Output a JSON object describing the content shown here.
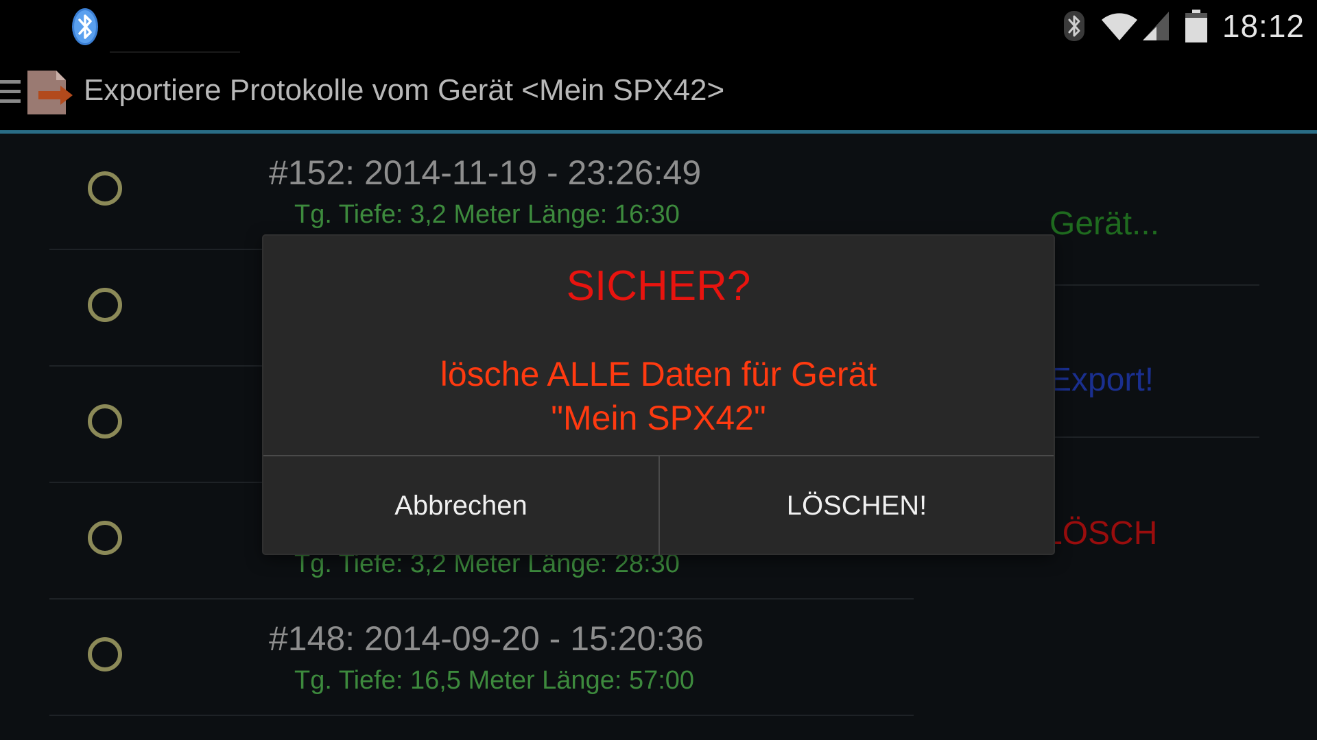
{
  "status_bar": {
    "time": "18:12",
    "icons": [
      "bluetooth-icon",
      "bluetooth-status-icon",
      "wifi-icon",
      "signal-icon",
      "battery-icon"
    ]
  },
  "action_bar": {
    "title": "Exportiere Protokolle vom Gerät <Mein SPX42>",
    "icons": [
      "drawer-menu-icon",
      "export-app-icon"
    ]
  },
  "logs": [
    {
      "title": "#152: 2014-11-19 - 23:26:49",
      "detail": "Tg. Tiefe: 3,2 Meter Länge: 16:30"
    },
    {
      "title": "",
      "detail": ""
    },
    {
      "title": "",
      "detail": ""
    },
    {
      "title": "",
      "detail": "Tg. Tiefe: 3,2 Meter Länge: 28:30"
    },
    {
      "title": "#148: 2014-09-20 - 15:20:36",
      "detail": "Tg. Tiefe: 16,5 Meter Länge: 57:00"
    }
  ],
  "side_buttons": {
    "device": "Gerät...",
    "export": "Export!",
    "delete": "LÖSCH"
  },
  "colors": {
    "device": "#1f6b1f",
    "export": "#1a2f8f",
    "delete": "#9a0d0d",
    "dialog_title": "#e8140f",
    "dialog_message": "#ff3a10",
    "accent_line": "#2a6d86"
  },
  "dialog": {
    "title": "SICHER?",
    "message_line1": "lösche ALLE Daten für Gerät",
    "message_line2": "\"Mein SPX42\"",
    "cancel_label": "Abbrechen",
    "confirm_label": "LÖSCHEN!"
  }
}
